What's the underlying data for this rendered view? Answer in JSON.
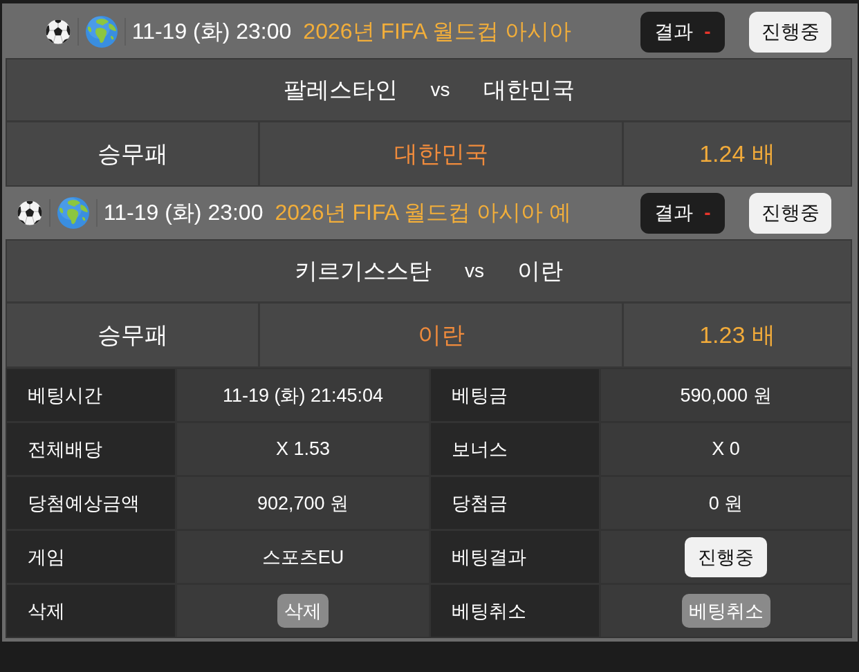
{
  "matches": [
    {
      "datetime": "11-19 (화) 23:00",
      "league": "2026년 FIFA 월드컵 아시아",
      "result": {
        "label": "결과",
        "value": "-"
      },
      "status": "진행중",
      "home": "팔레스타인",
      "vs": "vs",
      "away": "대한민국",
      "market": "승무패",
      "pick": "대한민국",
      "odds": "1.24 배"
    },
    {
      "datetime": "11-19 (화) 23:00",
      "league": "2026년 FIFA 월드컵 아시아 예",
      "result": {
        "label": "결과",
        "value": "-"
      },
      "status": "진행중",
      "home": "키르기스스탄",
      "vs": "vs",
      "away": "이란",
      "market": "승무패",
      "pick": "이란",
      "odds": "1.23 배"
    }
  ],
  "details": [
    {
      "items": [
        {
          "label": "베팅시간",
          "kind": "text",
          "value": "11-19 (화) 21:45:04"
        },
        {
          "label": "베팅금",
          "kind": "text",
          "value": "590,000 원"
        }
      ]
    },
    {
      "items": [
        {
          "label": "전체배당",
          "kind": "text",
          "value": "X 1.53"
        },
        {
          "label": "보너스",
          "kind": "text",
          "value": "X 0"
        }
      ]
    },
    {
      "items": [
        {
          "label": "당첨예상금액",
          "kind": "text",
          "value": "902,700 원"
        },
        {
          "label": "당첨금",
          "kind": "text",
          "value": "0 원"
        }
      ]
    },
    {
      "items": [
        {
          "label": "게임",
          "kind": "text",
          "value": "스포츠EU"
        },
        {
          "label": "베팅결과",
          "kind": "status",
          "value": "진행중"
        }
      ]
    },
    {
      "items": [
        {
          "label": "삭제",
          "kind": "button",
          "value": "삭제"
        },
        {
          "label": "베팅취소",
          "kind": "button",
          "value": "베팅취소"
        }
      ]
    }
  ]
}
